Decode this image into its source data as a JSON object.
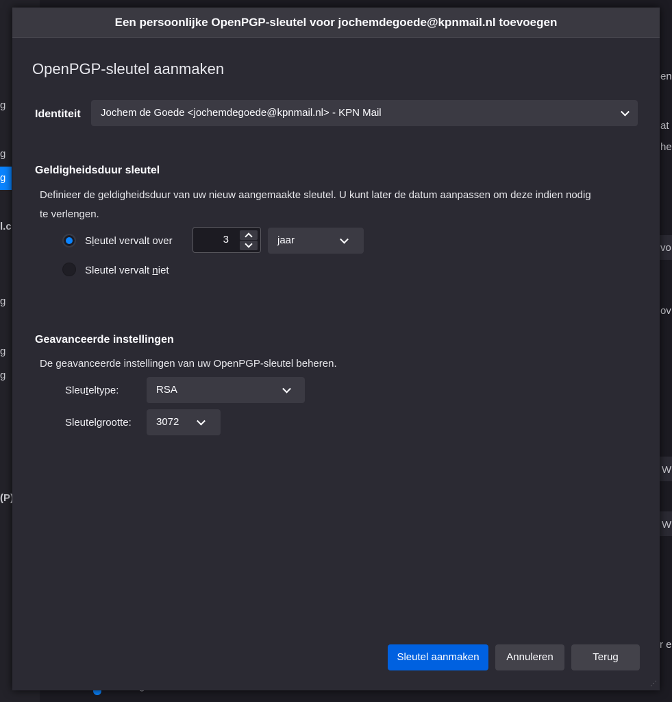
{
  "dialog": {
    "title": "Een persoonlijke OpenPGP-sleutel voor jochemdegoede@kpnmail.nl toevoegen",
    "heading": "OpenPGP-sleutel aanmaken",
    "identity": {
      "label": "Identiteit",
      "value": "Jochem de Goede <jochemdegoede@kpnmail.nl> - KPN Mail"
    },
    "validity": {
      "title": "Geldigheidsduur sleutel",
      "description_line1": "Definieer de geldigheidsduur van uw nieuw aangemaakte sleutel. U kunt later de datum aanpassen om deze indien nodig",
      "description_line2": "te verlengen.",
      "expires_label_pre": "S",
      "expires_label_u": "l",
      "expires_label_post": "eutel vervalt over",
      "expires_amount": "3",
      "expires_unit": "jaar",
      "never_label_pre": "Sleutel vervalt ",
      "never_label_u": "n",
      "never_label_post": "iet",
      "selected": "expires"
    },
    "advanced": {
      "title": "Geavanceerde instellingen",
      "description": "De geavanceerde instellingen van uw OpenPGP-sleutel beheren.",
      "keytype_label_pre": "Sleu",
      "keytype_label_u": "t",
      "keytype_label_post": "eltype:",
      "keytype_value": "RSA",
      "keysize_label_pre": "Sleutel",
      "keysize_label_u": "g",
      "keysize_label_post": "rootte:",
      "keysize_value": "3072"
    },
    "buttons": {
      "create": "Sleutel aanmaken",
      "cancel": "Annuleren",
      "back": "Terug"
    }
  },
  "background": {
    "left_fragments": [
      "g",
      "g",
      "g",
      "l.c",
      "g",
      "g",
      "g",
      "(P)"
    ],
    "selected_fragment": "g",
    "right_fragments": [
      "en",
      "at",
      "he",
      "vo",
      "ov",
      "W",
      "W",
      "r e"
    ],
    "bottom_text": "Versleuteling standaard niet inschakelen"
  }
}
